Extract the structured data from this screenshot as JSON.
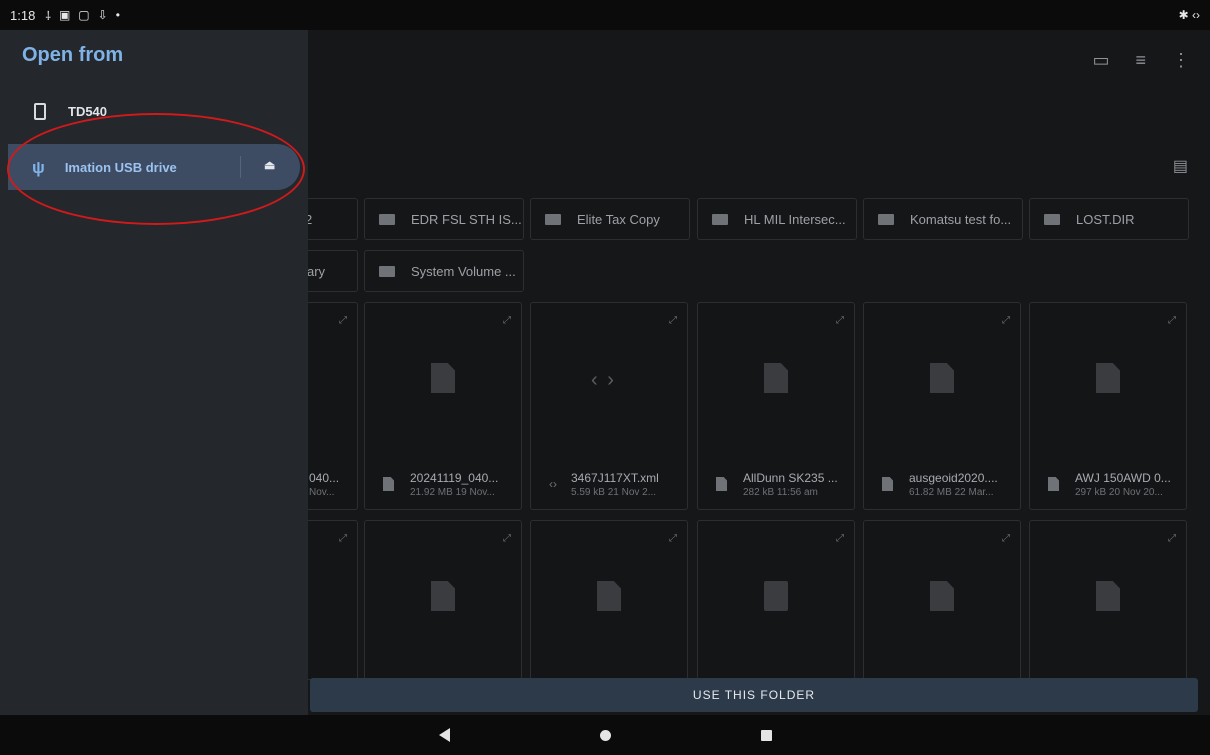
{
  "status": {
    "time": "1:18",
    "icons": [
      "usb-icon",
      "a-icon",
      "notification-icon",
      "download-icon",
      "dot-icon"
    ],
    "right_icons": [
      "bluetooth-icon",
      "code-icon"
    ]
  },
  "drawer": {
    "title": "Open from",
    "device_label": "TD540",
    "usb_label": "Imation USB drive"
  },
  "toolbar": {
    "icons": [
      "new-folder-icon",
      "sort-icon",
      "more-icon"
    ],
    "list_view_icon": "list-view-icon"
  },
  "folders_row1": [
    "2",
    "EDR FSL STH IS...",
    "Elite Tax Copy",
    "HL MIL Intersec...",
    "Komatsu test fo...",
    "LOST.DIR"
  ],
  "folders_row2": [
    "ary",
    "System Volume ..."
  ],
  "files_row1": [
    {
      "name": "040...",
      "sub": "Nov...",
      "icon": "file"
    },
    {
      "name": "20241119_040...",
      "sub": "21.92 MB 19 Nov...",
      "icon": "file"
    },
    {
      "name": "3467J117XT.xml",
      "sub": "5.59 kB 21 Nov 2...",
      "icon": "code"
    },
    {
      "name": "AllDunn SK235 ...",
      "sub": "282 kB 11:56 am",
      "icon": "file"
    },
    {
      "name": "ausgeoid2020....",
      "sub": "61.82 MB 22 Mar...",
      "icon": "file"
    },
    {
      "name": "AWJ 150AWD 0...",
      "sub": "297 kB 20 Nov 20...",
      "icon": "file"
    }
  ],
  "files_row2_icons": [
    "expand",
    "file",
    "file",
    "zip",
    "doc",
    "file"
  ],
  "use_folder_label": "USE THIS FOLDER",
  "nav": {
    "back": "back-icon",
    "home": "home-icon",
    "recents": "recents-icon"
  }
}
